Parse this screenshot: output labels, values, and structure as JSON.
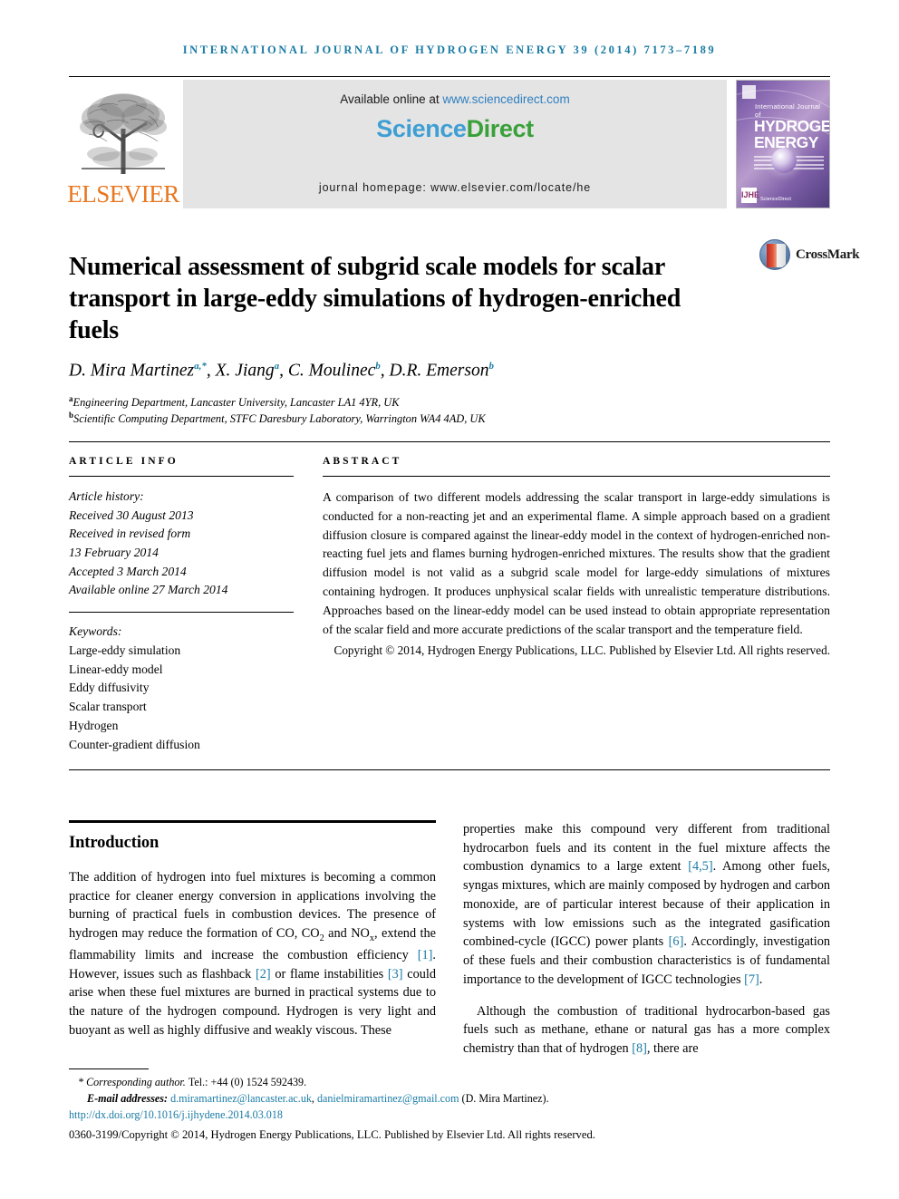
{
  "running_head": "International Journal of Hydrogen Energy 39 (2014) 7173–7189",
  "masthead": {
    "elsevier_wordmark": "ELSEVIER",
    "elsevier_logo_icon": "elsevier-tree-logo",
    "available_prefix": "Available online at ",
    "available_url": "www.sciencedirect.com",
    "sciencedirect_part1": "Science",
    "sciencedirect_part2": "Direct",
    "homepage": "journal homepage: www.elsevier.com/locate/he",
    "cover": {
      "line_small": "International Journal of",
      "line_big_1": "HYDROGEN",
      "line_big_2": "ENERGY",
      "badge": "IJHE",
      "sd_credit": "ScienceDirect"
    }
  },
  "article": {
    "title": "Numerical assessment of subgrid scale models for scalar transport in large-eddy simulations of hydrogen-enriched fuels",
    "crossmark_label": "CrossMark",
    "crossmark_icon": "crossmark-icon",
    "authors_html": "D. Mira Martinez<sup class=\"star\">a,*</sup>, X. Jiang<sup>a</sup>, C. Moulinec<sup>b</sup>, D.R. Emerson<sup>b</sup>",
    "affiliations": [
      {
        "marker": "a",
        "text": "Engineering Department, Lancaster University, Lancaster LA1 4YR, UK"
      },
      {
        "marker": "b",
        "text": "Scientific Computing Department, STFC Daresbury Laboratory, Warrington WA4 4AD, UK"
      }
    ]
  },
  "article_info": {
    "heading": "Article info",
    "history_label": "Article history:",
    "history": [
      "Received 30 August 2013",
      "Received in revised form",
      "13 February 2014",
      "Accepted 3 March 2014",
      "Available online 27 March 2014"
    ],
    "keywords_label": "Keywords:",
    "keywords": [
      "Large-eddy simulation",
      "Linear-eddy model",
      "Eddy diffusivity",
      "Scalar transport",
      "Hydrogen",
      "Counter-gradient diffusion"
    ]
  },
  "abstract": {
    "heading": "Abstract",
    "body": "A comparison of two different models addressing the scalar transport in large-eddy simulations is conducted for a non-reacting jet and an experimental flame. A simple approach based on a gradient diffusion closure is compared against the linear-eddy model in the context of hydrogen-enriched non-reacting fuel jets and flames burning hydrogen-enriched mixtures. The results show that the gradient diffusion model is not valid as a subgrid scale model for large-eddy simulations of mixtures containing hydrogen. It produces unphysical scalar fields with unrealistic temperature distributions. Approaches based on the linear-eddy model can be used instead to obtain appropriate representation of the scalar field and more accurate predictions of the scalar transport and the temperature field.",
    "copyright": "Copyright © 2014, Hydrogen Energy Publications, LLC. Published by Elsevier Ltd. All rights reserved."
  },
  "body": {
    "section_title": "Introduction",
    "left_paragraph_html": "The addition of hydrogen into fuel mixtures is becoming a common practice for cleaner energy conversion in applications involving the burning of practical fuels in combustion devices. The presence of hydrogen may reduce the formation of CO, CO<sub>2</sub> and NO<sub>x</sub>, extend the flammability limits and increase the combustion efficiency <span class=\"ref\">[1]</span>. However, issues such as flashback <span class=\"ref\">[2]</span> or flame instabilities <span class=\"ref\">[3]</span> could arise when these fuel mixtures are burned in practical systems due to the nature of the hydrogen compound. Hydrogen is very light and buoyant as well as highly diffusive and weakly viscous. These",
    "right_paragraph_1_html": "properties make this compound very different from traditional hydrocarbon fuels and its content in the fuel mixture affects the combustion dynamics to a large extent <span class=\"ref\">[4,5]</span>. Among other fuels, syngas mixtures, which are mainly composed by hydrogen and carbon monoxide, are of particular interest because of their application in systems with low emissions such as the integrated gasification combined-cycle (IGCC) power plants <span class=\"ref\">[6]</span>. Accordingly, investigation of these fuels and their combustion characteristics is of fundamental importance to the development of IGCC technologies <span class=\"ref\">[7]</span>.",
    "right_paragraph_2_html": "Although the combustion of traditional hydrocarbon-based gas fuels such as methane, ethane or natural gas has a more complex chemistry than that of hydrogen <span class=\"ref\">[8]</span>, there are"
  },
  "footer": {
    "corresponding_html": "<span class=\"star\">*</span> Corresponding author. <span class=\"tel\">Tel.: +44 (0) 1524 592439.</span>",
    "email_label": "E-mail addresses:",
    "email_1": "d.miramartinez@lancaster.ac.uk",
    "email_2": "danielmiramartinez@gmail.com",
    "email_owner": "(D. Mira Martinez).",
    "doi": "http://dx.doi.org/10.1016/j.ijhydene.2014.03.018",
    "issn_line": "0360-3199/Copyright © 2014, Hydrogen Energy Publications, LLC. Published by Elsevier Ltd. All rights reserved.",
    "issn_bold": "0360-3199/"
  },
  "colors": {
    "accent_blue": "#1a7ba5",
    "elsevier_orange": "#e87722",
    "sciencedirect_green": "#3aa03a",
    "link_blue": "#2f7fc0"
  }
}
